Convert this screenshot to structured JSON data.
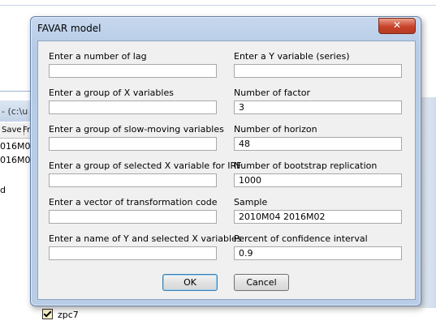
{
  "background": {
    "window_title": "- (c:\\u",
    "toolbar": [
      "Save",
      "Fr"
    ],
    "rows": [
      "016M02",
      "016M02",
      "d"
    ],
    "list_item": "zpc7"
  },
  "dialog": {
    "title": "FAVAR model",
    "close_glyph": "✕",
    "left_fields": [
      {
        "label": "Enter a number of lag",
        "value": ""
      },
      {
        "label": "Enter a group of X variables",
        "value": ""
      },
      {
        "label": "Enter a group of slow-moving variables",
        "value": ""
      },
      {
        "label": "Enter a group of selected X variable for IRF",
        "value": ""
      },
      {
        "label": "Enter a vector of transformation code",
        "value": ""
      },
      {
        "label": "Enter a name of Y and selected X variables",
        "value": ""
      }
    ],
    "right_fields": [
      {
        "label": "Enter a Y variable (series)",
        "value": ""
      },
      {
        "label": "Number of factor",
        "value": "3"
      },
      {
        "label": "Number of horizon",
        "value": "48"
      },
      {
        "label": "Number of bootstrap replication",
        "value": "1000"
      },
      {
        "label": "Sample",
        "value": "2010M04 2016M02"
      },
      {
        "label": "Percent of confidence interval",
        "value": "0.9"
      }
    ],
    "ok_label": "OK",
    "cancel_label": "Cancel"
  }
}
